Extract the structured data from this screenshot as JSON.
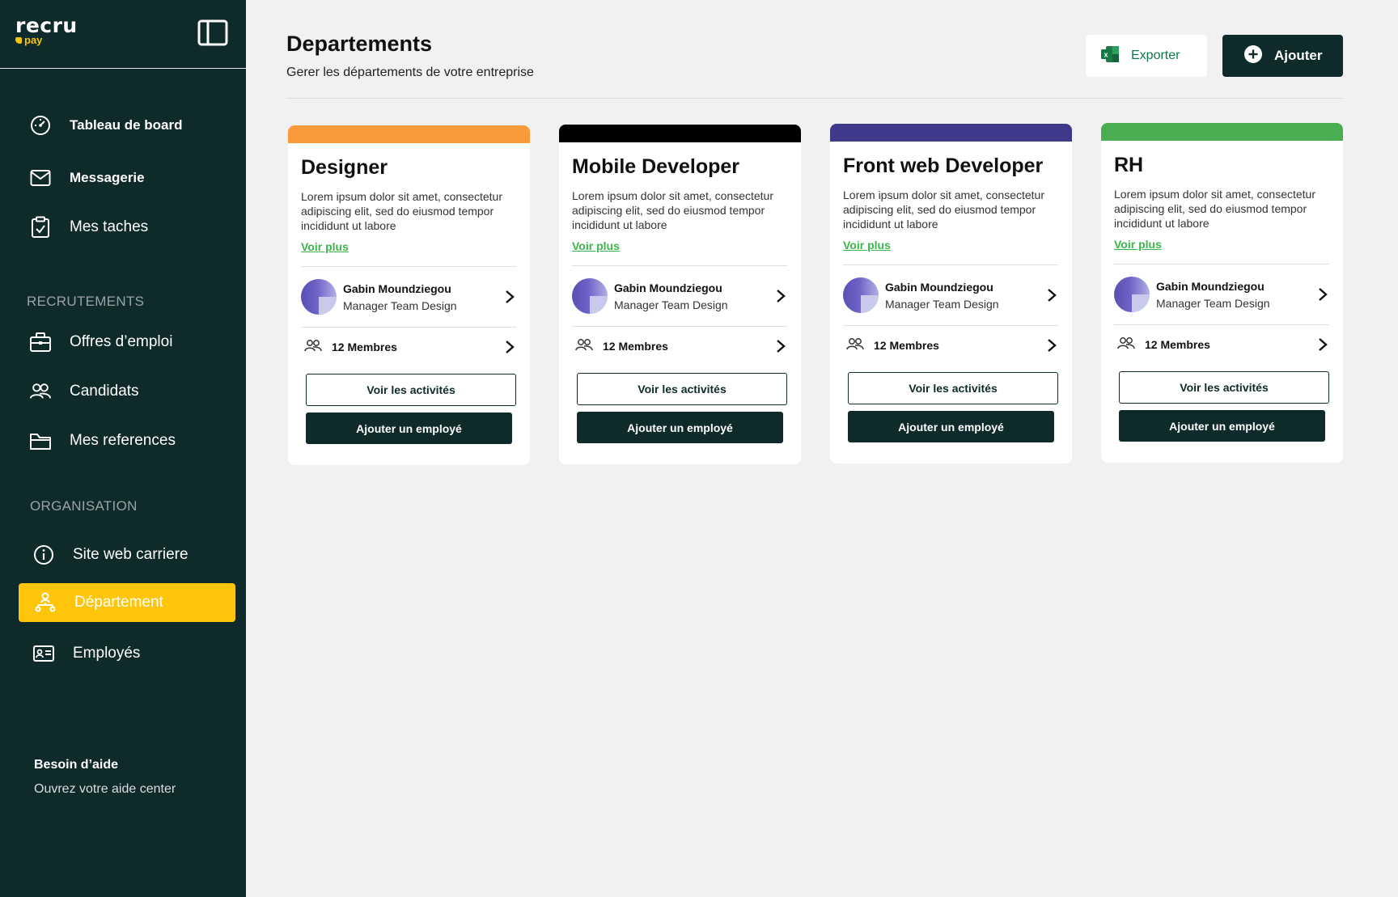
{
  "brand": {
    "name": "recru",
    "sub": "pay",
    "accent": "#fec50a",
    "sidebar_bg": "#0f2a2a"
  },
  "sidebar": {
    "top_items": [
      {
        "label": "Tableau de board",
        "icon": "dashboard-icon"
      },
      {
        "label": "Messagerie",
        "icon": "mail-icon"
      },
      {
        "label": "Mes taches",
        "icon": "clipboard-check-icon"
      }
    ],
    "section_recrutements": "RECRUTEMENTS",
    "recrutements_items": [
      {
        "label": "Offres d’emploi",
        "icon": "briefcase-icon"
      },
      {
        "label": "Candidats",
        "icon": "users-icon"
      },
      {
        "label": "Mes references",
        "icon": "folder-icon"
      }
    ],
    "section_organisation": "ORGANISATION",
    "organisation_items": [
      {
        "label": "Site web carriere",
        "icon": "info-icon"
      },
      {
        "label": "Département",
        "icon": "org-chart-icon",
        "active": true
      },
      {
        "label": "Employés",
        "icon": "id-card-icon"
      }
    ],
    "help_title": "Besoin d’aide",
    "help_sub": "Ouvrez votre aide center"
  },
  "header": {
    "title": "Departements",
    "subtitle": "Gerer les départements de votre entreprise",
    "export_label": "Exporter",
    "add_label": "Ajouter"
  },
  "cards": [
    {
      "title": "Designer",
      "color": "#fb9a3b",
      "description": "Lorem ipsum dolor sit amet, consectetur adipiscing elit, sed do eiusmod tempor incididunt ut labore",
      "more": "Voir plus",
      "manager_name": "Gabin Moundziegou",
      "manager_role": "Manager Team Design",
      "members": "12 Membres",
      "activities_label": "Voir les activités",
      "add_employee_label": "Ajouter un employé"
    },
    {
      "title": "Mobile Developer",
      "color": "#000000",
      "description": "Lorem ipsum dolor sit amet, consectetur adipiscing elit, sed do eiusmod tempor incididunt ut labore",
      "more": "Voir plus",
      "manager_name": "Gabin Moundziegou",
      "manager_role": "Manager Team Design",
      "members": "12 Membres",
      "activities_label": "Voir les activités",
      "add_employee_label": "Ajouter un employé"
    },
    {
      "title": "Front web Developer",
      "color": "#3d3a8c",
      "description": "Lorem ipsum dolor sit amet, consectetur adipiscing elit, sed do eiusmod tempor incididunt ut labore",
      "more": "Voir plus",
      "manager_name": "Gabin Moundziegou",
      "manager_role": "Manager Team Design",
      "members": "12 Membres",
      "activities_label": "Voir les activités",
      "add_employee_label": "Ajouter un employé"
    },
    {
      "title": "RH",
      "color": "#49ad51",
      "description": "Lorem ipsum dolor sit amet, consectetur adipiscing elit, sed do eiusmod tempor incididunt ut labore",
      "more": "Voir plus",
      "manager_name": "Gabin Moundziegou",
      "manager_role": "Manager Team Design",
      "members": "12 Membres",
      "activities_label": "Voir les activités",
      "add_employee_label": "Ajouter un employé"
    }
  ]
}
